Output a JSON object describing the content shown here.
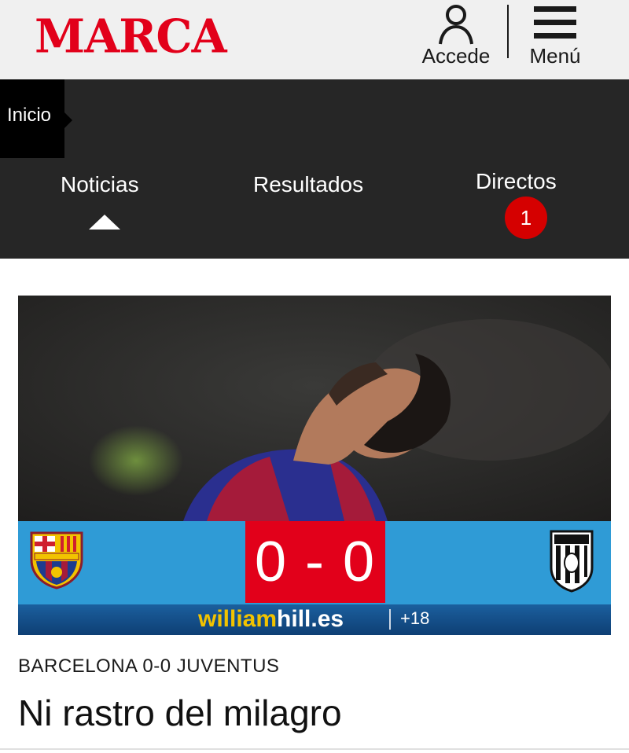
{
  "header": {
    "logo_text": "MARCA",
    "accede_label": "Accede",
    "menu_label": "Menú",
    "brand_color": "#e2001a"
  },
  "nav": {
    "home_label": "Inicio",
    "tabs": [
      {
        "label": "Noticias",
        "active": true
      },
      {
        "label": "Resultados",
        "active": false
      },
      {
        "label": "Directos",
        "active": false,
        "badge": "1"
      }
    ]
  },
  "article": {
    "score": "0 - 0",
    "home_team_crest": "fc-barcelona-crest",
    "away_team_crest": "juventus-crest",
    "sponsor": {
      "brand_a": "william",
      "brand_b": "hill.es",
      "age_notice": "+18"
    },
    "kicker": "BARCELONA 0-0 JUVENTUS",
    "headline": "Ni rastro del milagro",
    "colors": {
      "score_band": "#2f9bd6",
      "score_box": "#e2001a",
      "sponsor_bar": "#0e3f74"
    }
  }
}
